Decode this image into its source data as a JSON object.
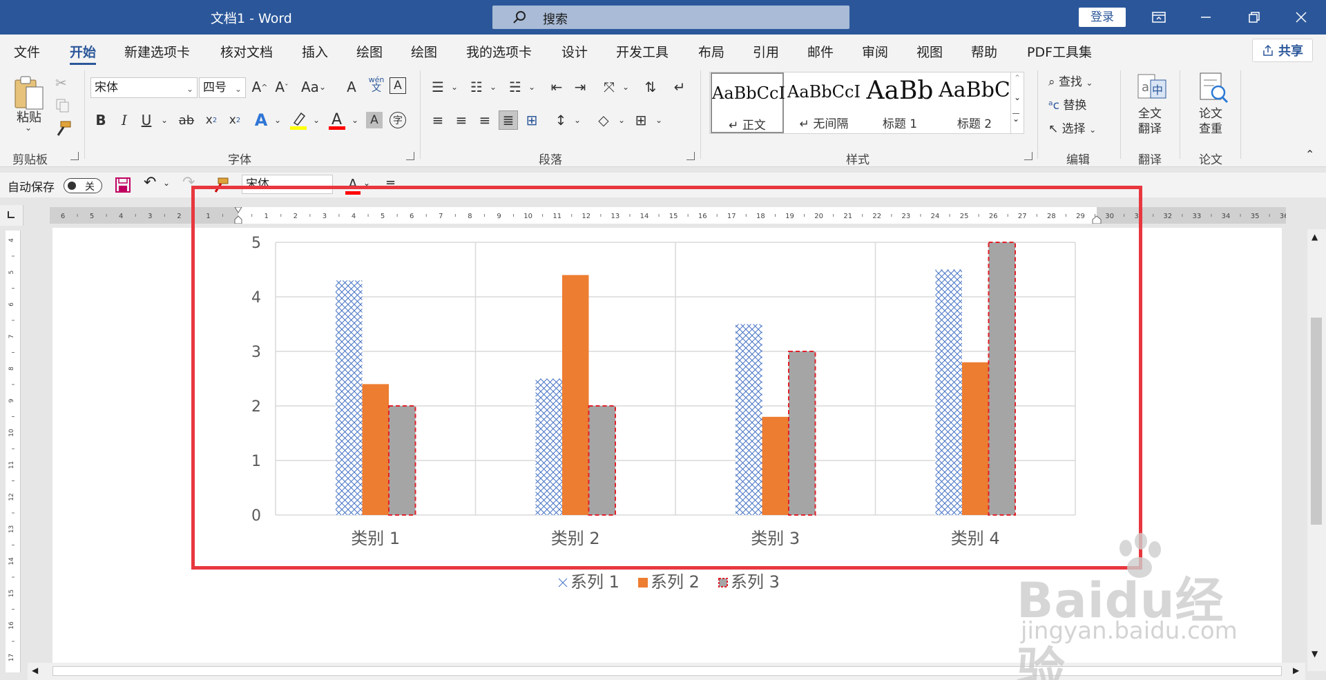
{
  "window": {
    "title": "文档1  -  Word",
    "search_placeholder": "搜索",
    "login_label": "登录",
    "share_label": "共享"
  },
  "menu": {
    "tabs": [
      "文件",
      "开始",
      "新建选项卡",
      "核对文档",
      "插入",
      "绘图",
      "绘图",
      "我的选项卡",
      "设计",
      "开发工具",
      "布局",
      "引用",
      "邮件",
      "审阅",
      "视图",
      "帮助",
      "PDF工具集"
    ],
    "active_index": 1
  },
  "ribbon": {
    "clipboard": {
      "paste_label": "粘贴",
      "group_label": "剪贴板"
    },
    "font": {
      "font_name": "宋体",
      "font_size": "四号",
      "group_label": "字体",
      "wen_label": "wén",
      "wen_sub": "文"
    },
    "paragraph": {
      "group_label": "段落"
    },
    "styles": {
      "group_label": "样式",
      "items": [
        {
          "sample": "AaBbCcI",
          "name": "↵ 正文"
        },
        {
          "sample": "AaBbCcI",
          "name": "↵ 无间隔"
        },
        {
          "sample": "AaBb",
          "name": "标题 1"
        },
        {
          "sample": "AaBbC",
          "name": "标题 2"
        }
      ]
    },
    "editing": {
      "find": "查找",
      "replace": "替换",
      "select": "选择",
      "group_label": "编辑"
    },
    "translate": {
      "button": "全文\n翻译",
      "line1": "全文",
      "line2": "翻译",
      "group_label": "翻译"
    },
    "paper": {
      "line1": "论文",
      "line2": "查重",
      "group_label": "论文"
    }
  },
  "quick_access": {
    "autosave_label": "自动保存",
    "toggle_state": "关",
    "font_name": "宋体"
  },
  "ruler": {
    "numbers": [
      "6",
      "5",
      "4",
      "3",
      "2",
      "1",
      "",
      "1",
      "2",
      "3",
      "4",
      "5",
      "6",
      "7",
      "8",
      "9",
      "10",
      "11",
      "12",
      "13",
      "14",
      "15",
      "16",
      "17",
      "18",
      "19",
      "20",
      "21",
      "22",
      "23",
      "24",
      "25",
      "26",
      "27",
      "28",
      "29",
      "30",
      "31",
      "32",
      "33",
      "34",
      "35",
      "36"
    ]
  },
  "vruler": {
    "numbers": [
      "4",
      "5",
      "6",
      "7",
      "8",
      "9",
      "10",
      "11",
      "12",
      "13",
      "14",
      "15",
      "16",
      "17"
    ]
  },
  "chart_data": {
    "type": "bar",
    "categories": [
      "类别 1",
      "类别 2",
      "类别 3",
      "类别 4"
    ],
    "series": [
      {
        "name": "系列 1",
        "values": [
          4.3,
          2.5,
          3.5,
          4.5
        ],
        "color": "#4472c4",
        "pattern": "crosshatch"
      },
      {
        "name": "系列 2",
        "values": [
          2.4,
          4.4,
          1.8,
          2.8
        ],
        "color": "#ed7d31",
        "pattern": "solid"
      },
      {
        "name": "系列 3",
        "values": [
          2,
          2,
          3,
          5
        ],
        "color": "#a5a5a5",
        "pattern": "solid-dashed-red-border"
      }
    ],
    "ylim": [
      0,
      5
    ],
    "yticks": [
      "0",
      "1",
      "2",
      "3",
      "4",
      "5"
    ],
    "grid": true,
    "legend": "bottom"
  },
  "watermark": {
    "logo": "Baidu经验",
    "url": "jingyan.baidu.com"
  },
  "colors": {
    "titlebar": "#2b579a",
    "highlight": "#e8373f"
  }
}
